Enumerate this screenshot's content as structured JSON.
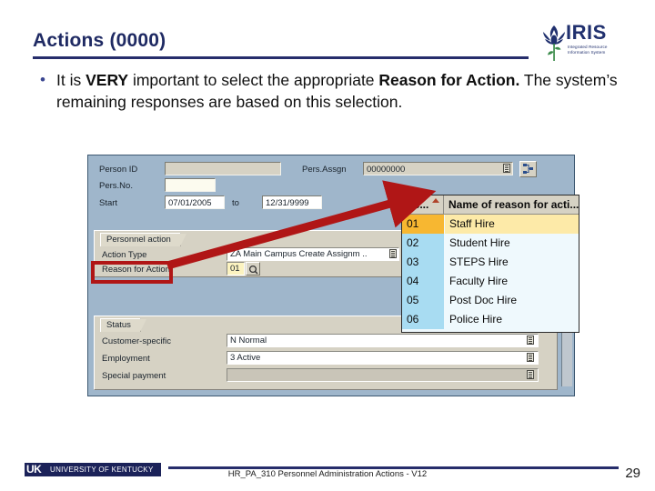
{
  "slide": {
    "title": "Actions (0000)",
    "bullet": {
      "segments": [
        {
          "text": "It is ",
          "bold": false
        },
        {
          "text": "VERY",
          "bold": true
        },
        {
          "text": " important to select the appropriate ",
          "bold": false
        },
        {
          "text": "Reason for Action.",
          "bold": true
        },
        {
          "text": "  The system’s remaining responses are based on this selection.",
          "bold": false
        }
      ]
    },
    "accent_color": "#262D6B"
  },
  "iris_logo": {
    "wordmark": "IRIS",
    "tagline_line1": "Integrated Resource",
    "tagline_line2": "Information System",
    "color": "#20306E"
  },
  "sap_screen": {
    "header": {
      "person_id_label": "Person ID",
      "person_id_value": "",
      "pers_assgn_label": "Pers.Assgn",
      "pers_assgn_value": "00000000",
      "pers_no_label": "Pers.No.",
      "pers_no_value": "",
      "start_label": "Start",
      "start_value": "07/01/2005",
      "to_label": "to",
      "end_value": "12/31/9999"
    },
    "personnel_action": {
      "tab_label": "Personnel action",
      "action_type_label": "Action Type",
      "action_type_value": "ZA Main Campus Create Assignm ..",
      "reason_label": "Reason for Action",
      "reason_value": "01"
    },
    "status": {
      "tab_label": "Status",
      "rows": [
        {
          "label": "Customer-specific",
          "value": "N Normal"
        },
        {
          "label": "Employment",
          "value": "3 Active"
        },
        {
          "label": "Special payment",
          "value": ""
        }
      ]
    },
    "dropdown": {
      "col1_header": "Ac...",
      "col2_header": "Name of reason for acti...",
      "rows": [
        {
          "key": "01",
          "name": "Staff Hire",
          "selected": true
        },
        {
          "key": "02",
          "name": "Student Hire",
          "selected": false
        },
        {
          "key": "03",
          "name": "STEPS Hire",
          "selected": false
        },
        {
          "key": "04",
          "name": "Faculty Hire",
          "selected": false
        },
        {
          "key": "05",
          "name": "Post Doc Hire",
          "selected": false
        },
        {
          "key": "06",
          "name": "Police Hire",
          "selected": false
        }
      ],
      "selected_color": "#F7B731"
    },
    "annotation_color": "#B01616"
  },
  "footer": {
    "uk_mark": "UK",
    "uk_name": "UNIVERSITY OF KENTUCKY",
    "course_text": "HR_PA_310 Personnel Administration Actions - V12",
    "page_number": "29"
  }
}
